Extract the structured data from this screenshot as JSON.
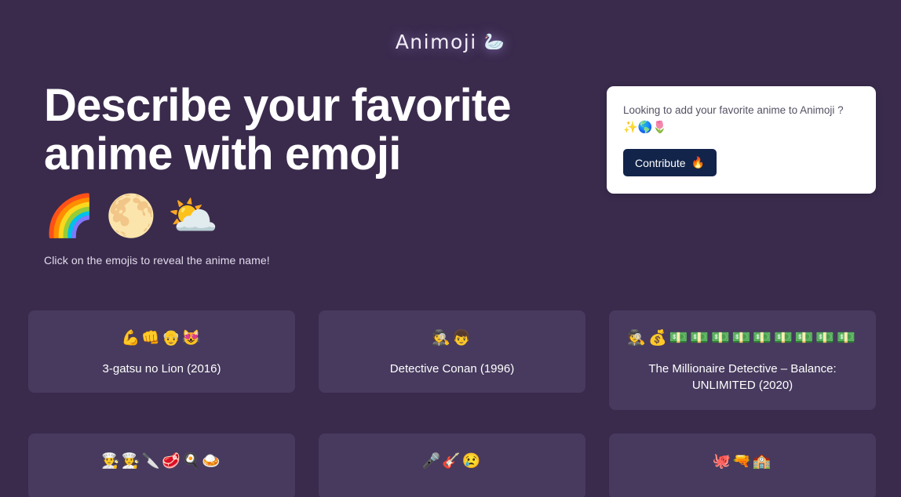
{
  "brand": {
    "name": "Animoji",
    "emoji": "🦢",
    "emoji_name": "swan-icon"
  },
  "hero": {
    "title": "Describe your favorite anime with emoji",
    "emojis": [
      "🌈",
      "🌕",
      "⛅"
    ],
    "hint": "Click on the emojis to reveal the anime name!"
  },
  "contribute": {
    "prompt": "Looking to add your favorite anime to Animoji ?",
    "prompt_emojis": "✨🌎🌷",
    "button_label": "Contribute",
    "button_emoji": "🔥"
  },
  "colors": {
    "background": "#3a2b4d",
    "card": "#473a5e",
    "card_white": "#ffffff",
    "button": "#12244a",
    "text": "#ffffff",
    "muted_text": "#555063"
  },
  "cards": [
    {
      "emojis": "💪👊👴😻",
      "title": "3-gatsu no Lion (2016)",
      "revealed": true
    },
    {
      "emojis": "🕵️👦",
      "title": "Detective Conan (1996)",
      "revealed": true
    },
    {
      "emojis": "🕵️💰💵💵💵💵💵💵💵💵💵",
      "title": "The Millionaire Detective – Balance: UNLIMITED (2020)",
      "revealed": true
    },
    {
      "emojis": "👨‍🍳👩‍🍳🔪🥩🍳🍛",
      "title": "",
      "revealed": false
    },
    {
      "emojis": "🎤🎸😢",
      "title": "",
      "revealed": false
    },
    {
      "emojis": "🐙🔫🏫",
      "title": "",
      "revealed": false
    }
  ]
}
